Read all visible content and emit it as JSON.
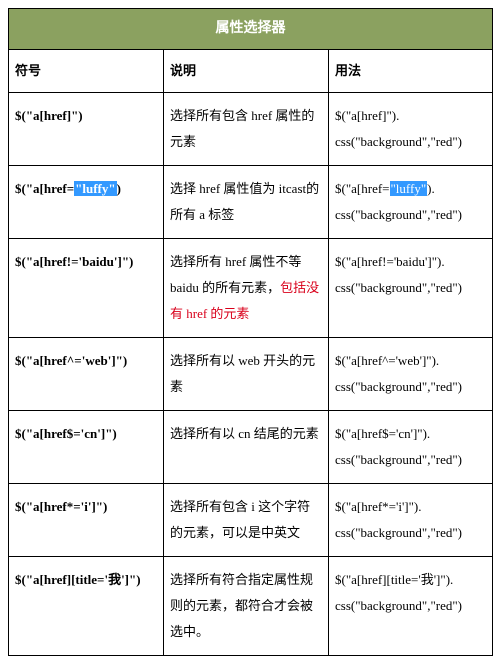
{
  "title": "属性选择器",
  "headers": {
    "symbol": "符号",
    "desc": "说明",
    "usage": "用法"
  },
  "rows": [
    {
      "symbol": "$(\"a[href]\")",
      "desc_pre": "选择所有包含 href 属性的元素",
      "usage_pre": "$(\"a[href]\"). css(\"background\",\"red\")"
    },
    {
      "symbol_pre": "$(\"a[href=",
      "symbol_hl": "\"luffy\"",
      "symbol_post": ")",
      "desc_pre": "选择 href 属性值为 itcast的所有 a 标签",
      "usage_pre": "$(\"a[href=",
      "usage_hl": "\"luffy\"",
      "usage_post": "). css(\"background\",\"red\")"
    },
    {
      "symbol": "$(\"a[href!='baidu']\")",
      "desc_pre": "选择所有 href 属性不等baidu 的所有元素，",
      "desc_red": "包括没有 href 的元素",
      "usage_pre": "$(\"a[href!='baidu']\"). css(\"background\",\"red\")"
    },
    {
      "symbol": "$(\"a[href^='web']\")",
      "desc_pre": "选择所有以 web 开头的元素",
      "usage_pre": "$(\"a[href^='web']\"). css(\"background\",\"red\")"
    },
    {
      "symbol": "$(\"a[href$='cn']\")",
      "desc_pre": "选择所有以 cn 结尾的元素",
      "usage_pre": "$(\"a[href$='cn']\"). css(\"background\",\"red\")"
    },
    {
      "symbol": "$(\"a[href*='i']\")",
      "desc_pre": "选择所有包含 i 这个字符的元素，可以是中英文",
      "usage_pre": "$(\"a[href*='i']\"). css(\"background\",\"red\")"
    },
    {
      "symbol": "$(\"a[href][title='我']\")",
      "desc_pre": "选择所有符合指定属性规则的元素，都符合才会被选中。",
      "usage_pre": "$(\"a[href][title='我']\"). css(\"background\",\"red\")"
    }
  ]
}
